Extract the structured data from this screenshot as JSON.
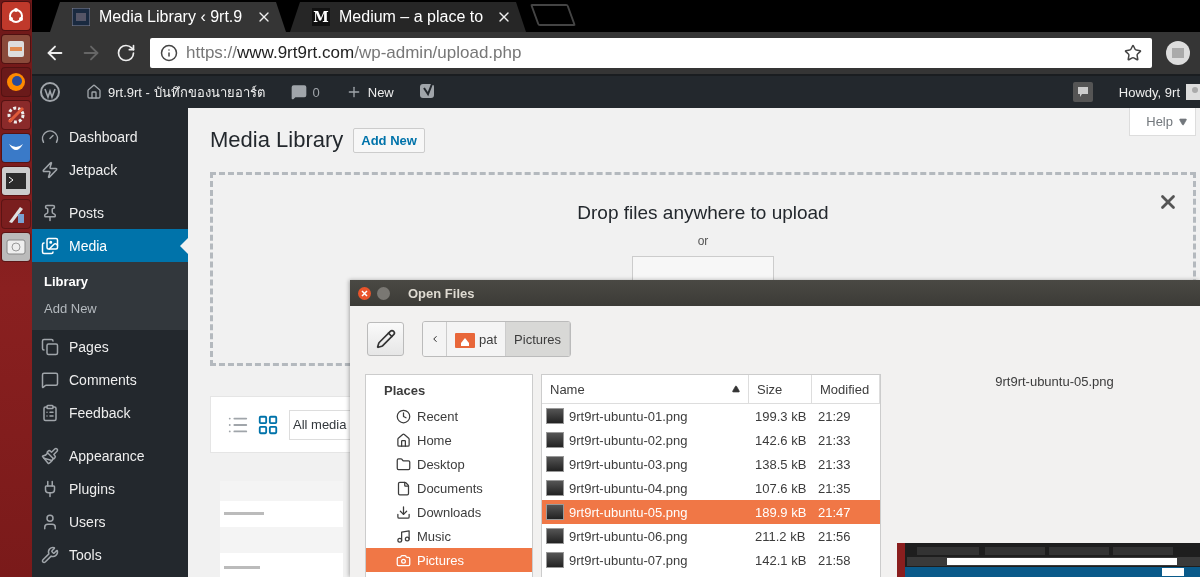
{
  "browser": {
    "tabs": [
      {
        "title": "Media Library ‹ 9rt.9",
        "selected": true
      },
      {
        "title": "Medium – a place to",
        "icon_text": "M",
        "selected": false
      }
    ],
    "navigation": {
      "back_disabled": false,
      "forward_disabled": true
    },
    "address": {
      "scheme": "https://",
      "host": "www.9rt9rt.com",
      "path": "/wp-admin/upload.php"
    }
  },
  "admin_bar": {
    "site_name": "9rt.9rt - บันทึกของนายอาร์ต",
    "comments": "0",
    "new": "New",
    "greeting": "Howdy, 9rt"
  },
  "sidebar": {
    "groups": [
      [
        {
          "label": "Dashboard",
          "selected": false
        },
        {
          "label": "Jetpack",
          "selected": false
        }
      ],
      [
        {
          "label": "Posts",
          "selected": false
        },
        {
          "label": "Media",
          "selected": true,
          "children": [
            {
              "label": "Library",
              "selected": true
            },
            {
              "label": "Add New",
              "selected": false
            }
          ]
        },
        {
          "label": "Pages",
          "selected": false
        },
        {
          "label": "Comments",
          "selected": false
        },
        {
          "label": "Feedback",
          "selected": false
        }
      ],
      [
        {
          "label": "Appearance",
          "selected": false
        },
        {
          "label": "Plugins",
          "selected": false
        },
        {
          "label": "Users",
          "selected": false
        },
        {
          "label": "Tools",
          "selected": false
        }
      ]
    ]
  },
  "page": {
    "title": "Media Library",
    "add_new": "Add New",
    "help": "Help",
    "uploader": {
      "heading": "Drop files anywhere to upload",
      "or": "or"
    },
    "view_modes": [
      {
        "selected": false
      },
      {
        "selected": true
      }
    ],
    "filter": "All media"
  },
  "dialog": {
    "title": "Open Files",
    "path": [
      {
        "label": "pat",
        "selected": false
      },
      {
        "label": "Pictures",
        "selected": true
      }
    ],
    "places": {
      "heading": "Places",
      "items": [
        {
          "label": "Recent",
          "selected": false
        },
        {
          "label": "Home",
          "selected": false
        },
        {
          "label": "Desktop",
          "selected": false
        },
        {
          "label": "Documents",
          "selected": false
        },
        {
          "label": "Downloads",
          "selected": false
        },
        {
          "label": "Music",
          "selected": false
        },
        {
          "label": "Pictures",
          "selected": true
        }
      ]
    },
    "files": {
      "columns": [
        "Name",
        "Size",
        "Modified"
      ],
      "rows": [
        {
          "name": "9rt9rt-ubuntu-01.png",
          "size": "199.3 kB",
          "modified": "21:29",
          "selected": false
        },
        {
          "name": "9rt9rt-ubuntu-02.png",
          "size": "142.6 kB",
          "modified": "21:33",
          "selected": false
        },
        {
          "name": "9rt9rt-ubuntu-03.png",
          "size": "138.5 kB",
          "modified": "21:33",
          "selected": false
        },
        {
          "name": "9rt9rt-ubuntu-04.png",
          "size": "107.6 kB",
          "modified": "21:35",
          "selected": false
        },
        {
          "name": "9rt9rt-ubuntu-05.png",
          "size": "189.9 kB",
          "modified": "21:47",
          "selected": true
        },
        {
          "name": "9rt9rt-ubuntu-06.png",
          "size": "211.2 kB",
          "modified": "21:56",
          "selected": false
        },
        {
          "name": "9rt9rt-ubuntu-07.png",
          "size": "142.1 kB",
          "modified": "21:58",
          "selected": false
        }
      ]
    },
    "preview": {
      "filename": "9rt9rt-ubuntu-05.png"
    }
  }
}
